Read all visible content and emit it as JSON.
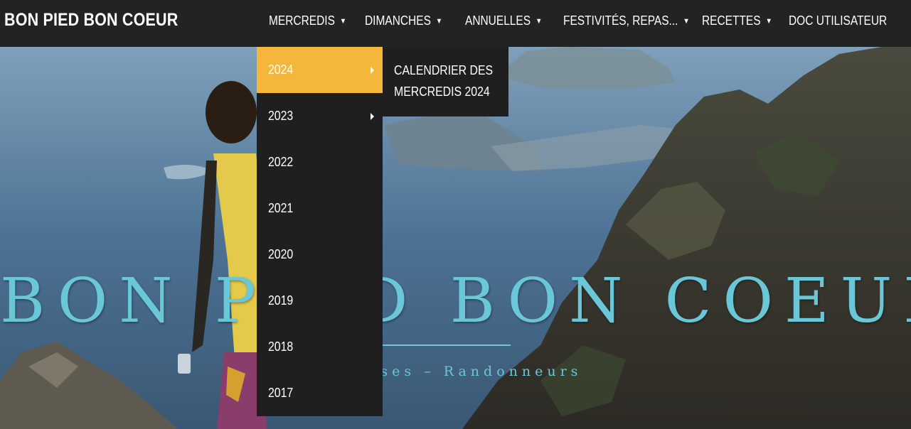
{
  "brand": "BON PIED BON COEUR",
  "nav": [
    {
      "label": "MERCREDIS",
      "caret": "▼"
    },
    {
      "label": "DIMANCHES",
      "caret": "▼"
    },
    {
      "label": "ANNUELLES",
      "caret": "▼"
    },
    {
      "label": "FESTIVITÉS, REPAS...",
      "caret": "▼"
    },
    {
      "label": "RECETTES",
      "caret": "▼"
    },
    {
      "label": "DOC UTILISATEUR",
      "caret": ""
    }
  ],
  "dropdown": {
    "items": [
      {
        "label": "2024",
        "has_submenu": true,
        "active": true
      },
      {
        "label": "2023",
        "has_submenu": true,
        "active": false
      },
      {
        "label": "2022",
        "has_submenu": false,
        "active": false
      },
      {
        "label": "2021",
        "has_submenu": false,
        "active": false
      },
      {
        "label": "2020",
        "has_submenu": false,
        "active": false
      },
      {
        "label": "2019",
        "has_submenu": false,
        "active": false
      },
      {
        "label": "2018",
        "has_submenu": false,
        "active": false
      },
      {
        "label": "2017",
        "has_submenu": false,
        "active": false
      }
    ],
    "submenu": {
      "label": "CALENDRIER DES MERCREDIS 2024"
    }
  },
  "hero": {
    "title": "BON PIED BON COEUR",
    "subtitle": "Randonneuses – Randonneurs"
  },
  "colors": {
    "topbar": "#232323",
    "menu_bg": "#1f1f1f",
    "active": "#f4b73c",
    "hero_text": "#6ac7d8"
  }
}
